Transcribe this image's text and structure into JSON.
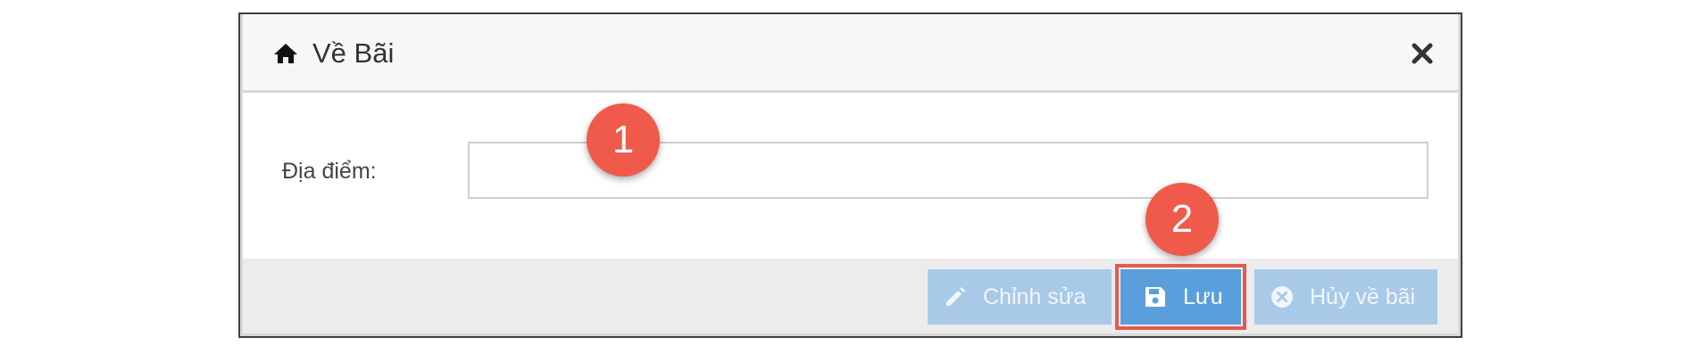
{
  "dialog": {
    "title": "Về Bãi",
    "close_icon": "close-icon",
    "home_icon": "home-icon"
  },
  "form": {
    "location_label": "Địa điểm:",
    "location_value": "",
    "location_placeholder": ""
  },
  "footer": {
    "edit_label": "Chỉnh sửa",
    "save_label": "Lưu",
    "cancel_label": "Hủy về bãi"
  },
  "annotations": {
    "step1": "1",
    "step2": "2"
  },
  "colors": {
    "primary": "#5a9fdc",
    "disabled_button": "#a9c9e8",
    "marker": "#f05a4a",
    "highlight_border": "#e45a4f"
  }
}
